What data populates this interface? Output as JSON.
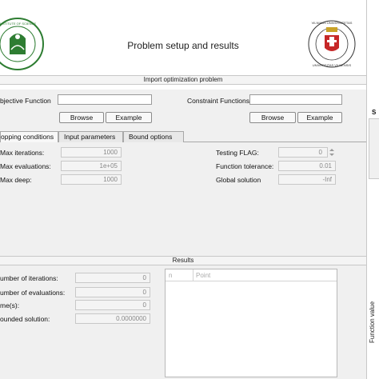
{
  "header": {
    "title": "Problem setup and results"
  },
  "import_panel": {
    "title": "Import optimization problem",
    "objective_label": "bjective Function",
    "constraint_label": "Constraint Functions",
    "objective_value": "",
    "constraint_value": "",
    "browse_label": "Browse",
    "example_label": "Example"
  },
  "tabs": [
    {
      "label": "opping conditions"
    },
    {
      "label": "Input parameters"
    },
    {
      "label": "Bound options"
    }
  ],
  "stopping": {
    "max_iterations_label": "Max iterations:",
    "max_iterations_value": "1000",
    "max_evaluations_label": "Max evaluations:",
    "max_evaluations_value": "1e+05",
    "max_deep_label": "Max deep:",
    "max_deep_value": "1000",
    "testing_flag_label": "Testing FLAG:",
    "testing_flag_value": "0",
    "function_tolerance_label": "Function tolerance:",
    "function_tolerance_value": "0.01",
    "global_solution_label": "Global solution",
    "global_solution_value": "-Inf"
  },
  "results": {
    "title": "Results",
    "iterations_label": "umber of iterations:",
    "iterations_value": "0",
    "evaluations_label": "umber of evaluations:",
    "evaluations_value": "0",
    "time_label": "me(s):",
    "time_value": "0",
    "bounded_label": "ounded solution:",
    "bounded_value": "0.0000000",
    "table_headers": [
      "n",
      "Point"
    ]
  },
  "right_strip": {
    "text": "Function value",
    "letter": "S"
  },
  "colors": {
    "accent_green": "#2e7d32",
    "logo_red": "#c62828",
    "logo_gold": "#c9a227"
  },
  "icons": [
    "university-green-logo",
    "vilnius-university-logo",
    "spinner-arrows-icon"
  ]
}
